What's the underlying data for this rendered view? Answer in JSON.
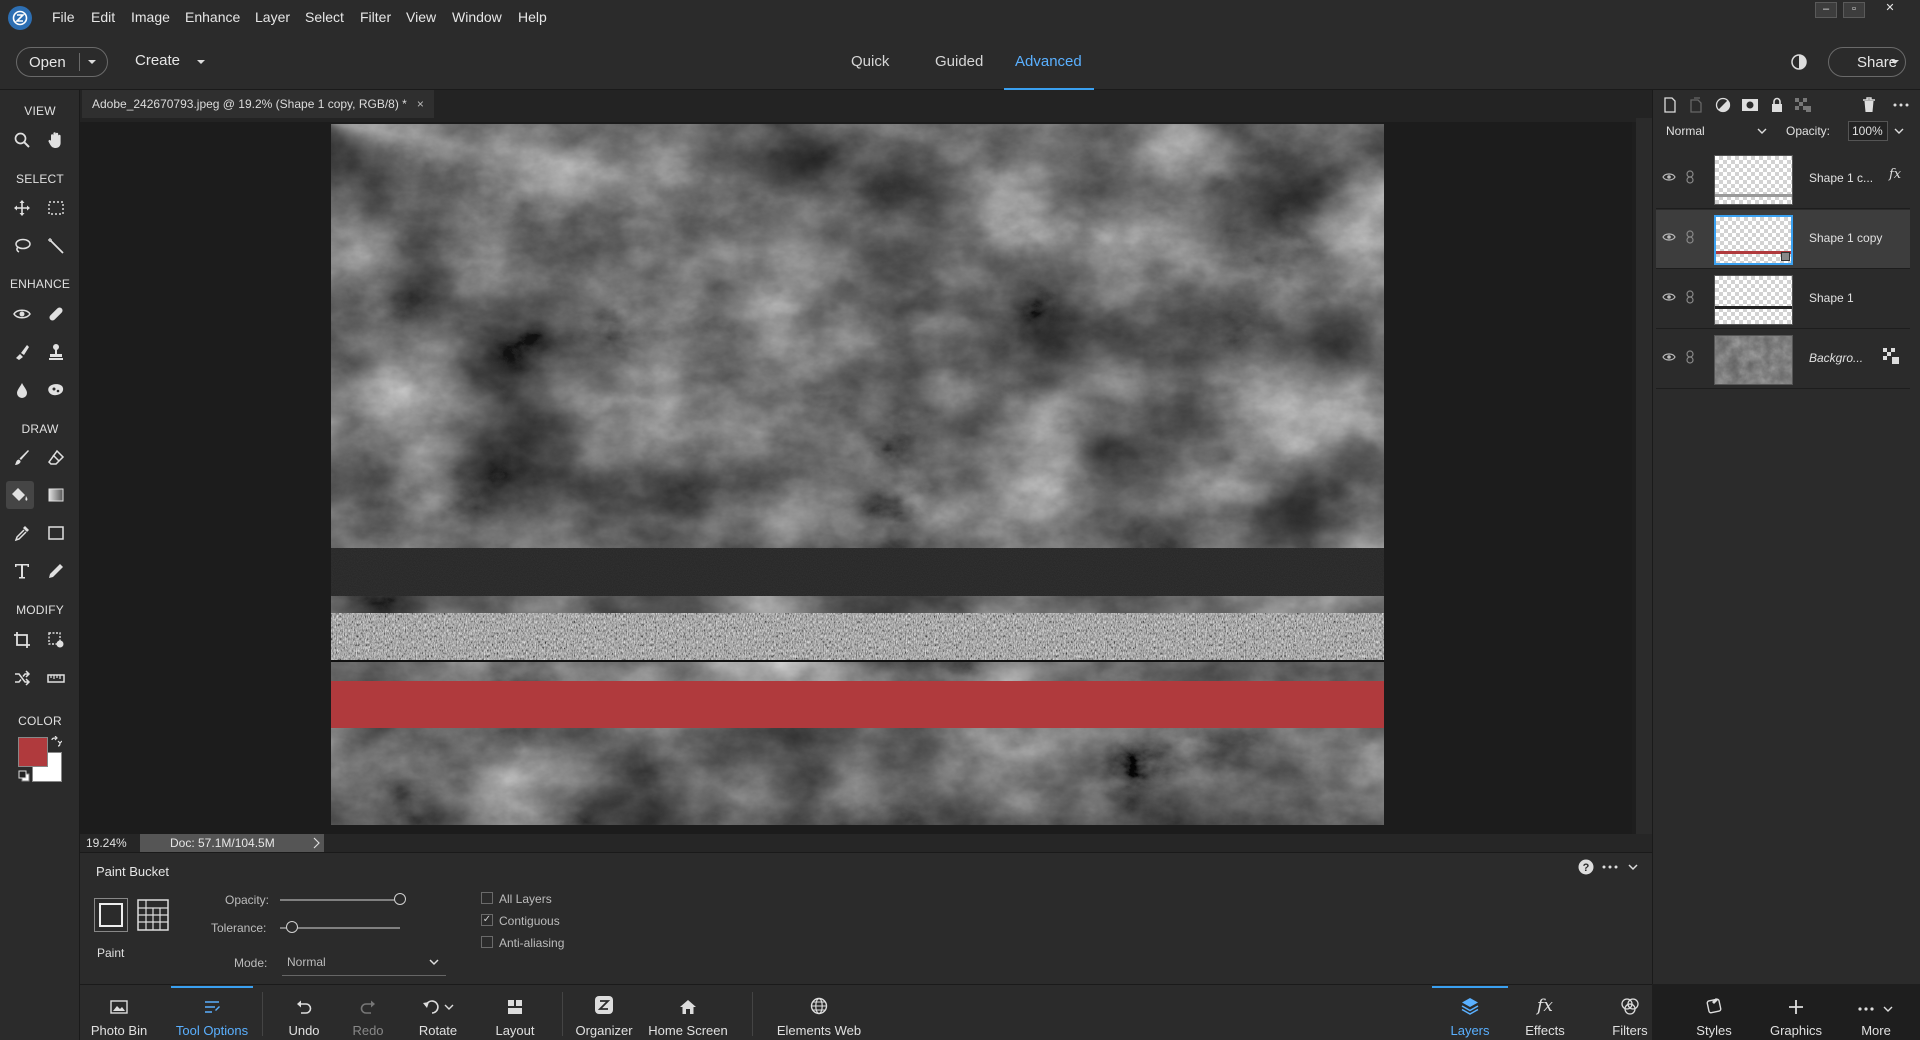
{
  "menu": {
    "items": [
      "File",
      "Edit",
      "Image",
      "Enhance",
      "Layer",
      "Select",
      "Filter",
      "View",
      "Window",
      "Help"
    ],
    "window_controls": [
      "–",
      "▫",
      "✕"
    ]
  },
  "modebar": {
    "open_label": "Open",
    "create_label": "Create",
    "tabs": [
      "Quick",
      "Guided",
      "Advanced"
    ],
    "active_tab": "Advanced",
    "share_label": "Share"
  },
  "toolbar": {
    "sections": [
      "VIEW",
      "SELECT",
      "ENHANCE",
      "DRAW",
      "MODIFY",
      "COLOR"
    ],
    "foreground_color": "#b03a3d",
    "background_color": "#ffffff",
    "active_tool": "paint-bucket"
  },
  "document": {
    "tab_title": "Adobe_242670793.jpeg @ 19.2% (Shape 1 copy, RGB/8) *",
    "close_glyph": "×",
    "zoom": "19.24%",
    "doc_size": "Doc: 57.1M/104.5M"
  },
  "tool_options": {
    "tool_name": "Paint Bucket",
    "fill_mode_label": "Paint",
    "opacity_label": "Opacity:",
    "opacity_value": 1.0,
    "tolerance_label": "Tolerance:",
    "tolerance_value": 0.1,
    "mode_label": "Mode:",
    "mode_value": "Normal",
    "checkboxes": [
      {
        "label": "All Layers",
        "checked": false
      },
      {
        "label": "Contiguous",
        "checked": true
      },
      {
        "label": "Anti-aliasing",
        "checked": false
      }
    ]
  },
  "taskbar": {
    "left": [
      {
        "label": "Photo Bin",
        "icon": "photo-bin-icon"
      },
      {
        "label": "Tool Options",
        "icon": "tool-options-icon",
        "active": true
      },
      {
        "label": "Undo",
        "icon": "undo-icon"
      },
      {
        "label": "Redo",
        "icon": "redo-icon"
      },
      {
        "label": "Rotate",
        "icon": "rotate-icon"
      },
      {
        "label": "Layout",
        "icon": "layout-icon"
      },
      {
        "label": "Organizer",
        "icon": "organizer-icon"
      },
      {
        "label": "Home Screen",
        "icon": "home-icon"
      },
      {
        "label": "Elements Web",
        "icon": "globe-icon"
      }
    ],
    "right": [
      {
        "label": "Layers",
        "icon": "layers-icon",
        "active": true
      },
      {
        "label": "Effects",
        "icon": "fx-icon"
      },
      {
        "label": "Filters",
        "icon": "filters-icon"
      },
      {
        "label": "Styles",
        "icon": "styles-icon"
      },
      {
        "label": "Graphics",
        "icon": "graphics-icon"
      },
      {
        "label": "More",
        "icon": "more-icon"
      }
    ]
  },
  "layers_panel": {
    "blend_mode": "Normal",
    "opacity_label": "Opacity:",
    "opacity_value": "100%",
    "layers": [
      {
        "name": "Shape 1 c...",
        "has_fx": true,
        "fx_glyph": "fx",
        "selected": false,
        "italic": false
      },
      {
        "name": "Shape 1 copy",
        "has_fx": false,
        "selected": true,
        "italic": false
      },
      {
        "name": "Shape 1",
        "has_fx": false,
        "selected": false,
        "italic": false
      },
      {
        "name": "Backgro...",
        "has_fx": false,
        "selected": false,
        "italic": true
      }
    ]
  },
  "colors": {
    "accent": "#3aa0f0",
    "red_stripe": "#b03a3d",
    "app_bg": "#2b2b2b"
  }
}
